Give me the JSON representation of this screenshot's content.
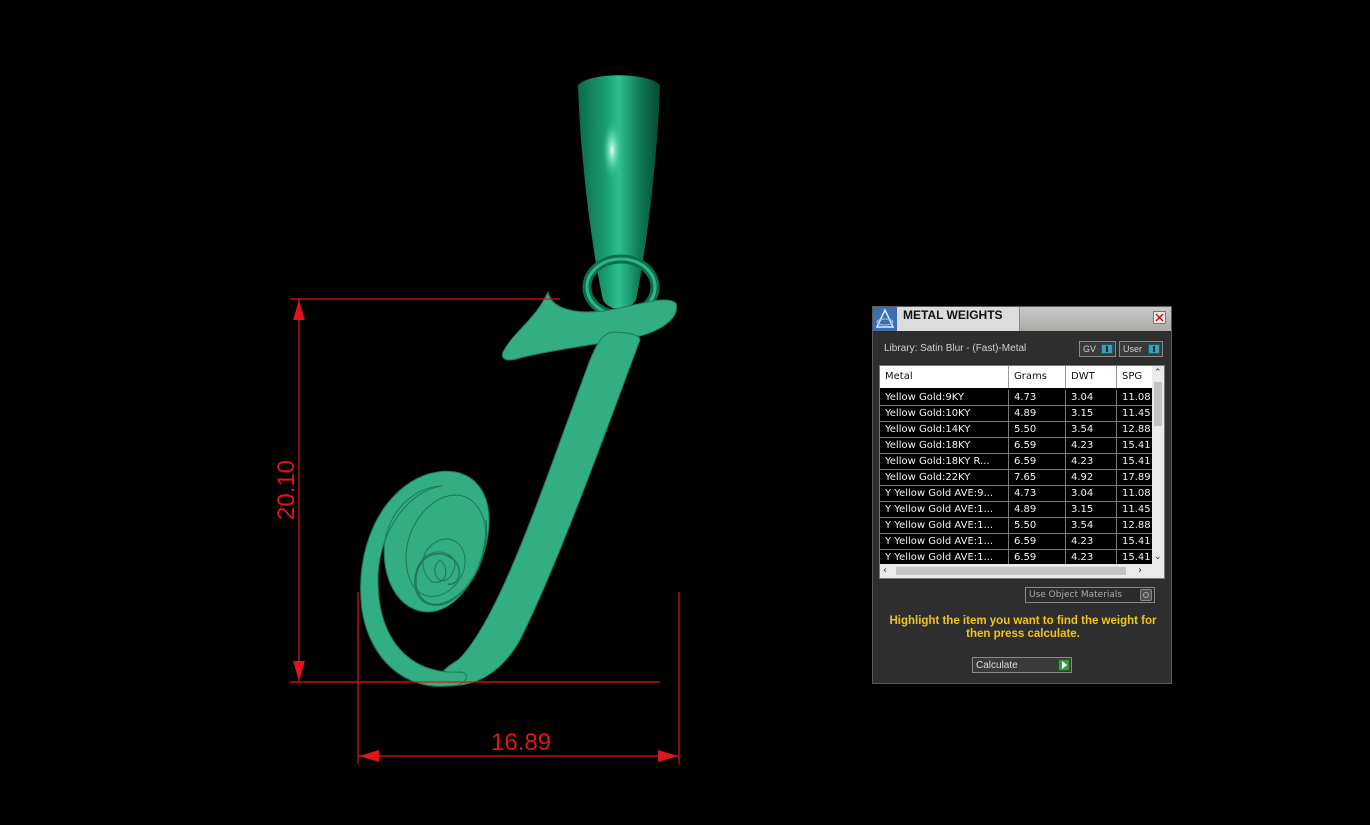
{
  "viewport": {
    "dimension_height": "20.10",
    "dimension_width": "16.89"
  },
  "panel": {
    "title": "METAL WEIGHTS",
    "library_label": "Library: Satin Blur - (Fast)-Metal",
    "toggle_gv_label": "GV",
    "toggle_user_label": "User",
    "columns": [
      "Metal",
      "Grams",
      "DWT",
      "SPG"
    ],
    "rows": [
      [
        "Yellow Gold:9KY",
        "4.73",
        "3.04",
        "11.08"
      ],
      [
        "Yellow Gold:10KY",
        "4.89",
        "3.15",
        "11.45"
      ],
      [
        "Yellow Gold:14KY",
        "5.50",
        "3.54",
        "12.88"
      ],
      [
        "Yellow Gold:18KY",
        "6.59",
        "4.23",
        "15.41"
      ],
      [
        "Yellow Gold:18KY R...",
        "6.59",
        "4.23",
        "15.41"
      ],
      [
        "Yellow Gold:22KY",
        "7.65",
        "4.92",
        "17.89"
      ],
      [
        "Y Yellow Gold AVE:9...",
        "4.73",
        "3.04",
        "11.08"
      ],
      [
        "Y Yellow Gold AVE:1...",
        "4.89",
        "3.15",
        "11.45"
      ],
      [
        "Y Yellow Gold AVE:1...",
        "5.50",
        "3.54",
        "12.88"
      ],
      [
        "Y Yellow Gold AVE:1...",
        "6.59",
        "4.23",
        "15.41"
      ],
      [
        "Y Yellow Gold AVE:1...",
        "6.59",
        "4.23",
        "15.41"
      ]
    ],
    "use_object_materials_label": "Use Object Materials",
    "instructions": "Highlight the item you want to find the weight for then press calculate.",
    "calculate_label": "Calculate"
  },
  "colors": {
    "background": "#000000",
    "pendant_green": "#33ad82",
    "dimension_red": "#e0141c",
    "instruction_yellow": "#f0c419"
  }
}
